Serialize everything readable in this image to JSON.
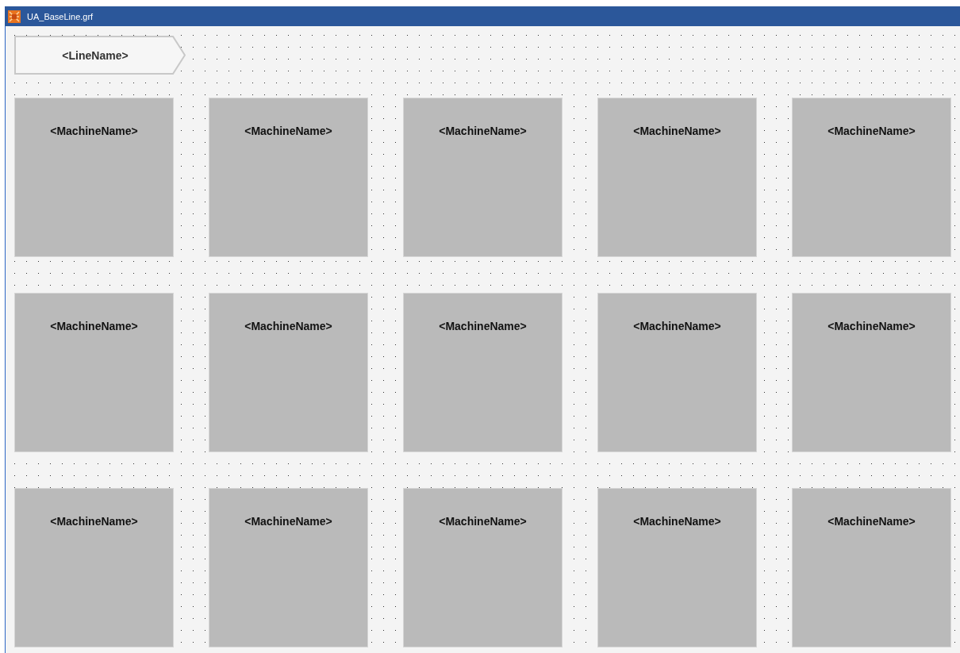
{
  "window": {
    "title": "UA_BaseLine.grf"
  },
  "line": {
    "name": "<LineName>"
  },
  "machines": [
    {
      "name": "<MachineName>"
    },
    {
      "name": "<MachineName>"
    },
    {
      "name": "<MachineName>"
    },
    {
      "name": "<MachineName>"
    },
    {
      "name": "<MachineName>"
    },
    {
      "name": "<MachineName>"
    },
    {
      "name": "<MachineName>"
    },
    {
      "name": "<MachineName>"
    },
    {
      "name": "<MachineName>"
    },
    {
      "name": "<MachineName>"
    },
    {
      "name": "<MachineName>"
    },
    {
      "name": "<MachineName>"
    },
    {
      "name": "<MachineName>"
    },
    {
      "name": "<MachineName>"
    },
    {
      "name": "<MachineName>"
    }
  ]
}
